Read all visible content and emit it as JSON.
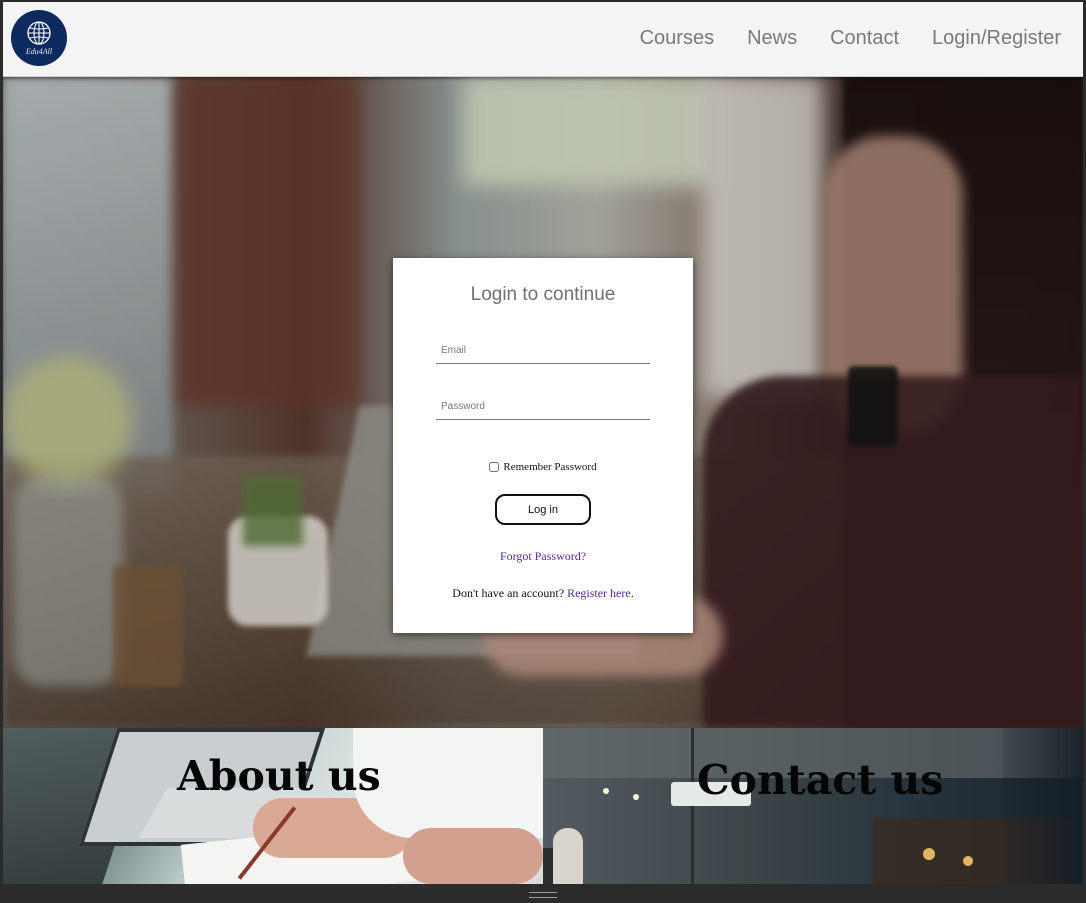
{
  "brand": {
    "logo_text": "Edu4All",
    "logo_color": "#0c2a5e"
  },
  "nav": {
    "items": [
      {
        "label": "Courses"
      },
      {
        "label": "News"
      },
      {
        "label": "Contact"
      },
      {
        "label": "Login/Register"
      }
    ]
  },
  "login": {
    "title": "Login to continue",
    "email_placeholder": "Email",
    "password_placeholder": "Password",
    "remember_label": "Remember Password",
    "remember_checked": false,
    "button_label": "Log in",
    "forgot_label": "Forgot Password?",
    "no_account_text": "Don't have an account?",
    "register_label": "Register here",
    "register_suffix": "."
  },
  "sections": {
    "about_label": "About us",
    "contact_label": "Contact us"
  },
  "colors": {
    "link": "#5a2a8a",
    "nav_text": "#7a7a7a",
    "navbar_bg": "#f4f4f4"
  }
}
